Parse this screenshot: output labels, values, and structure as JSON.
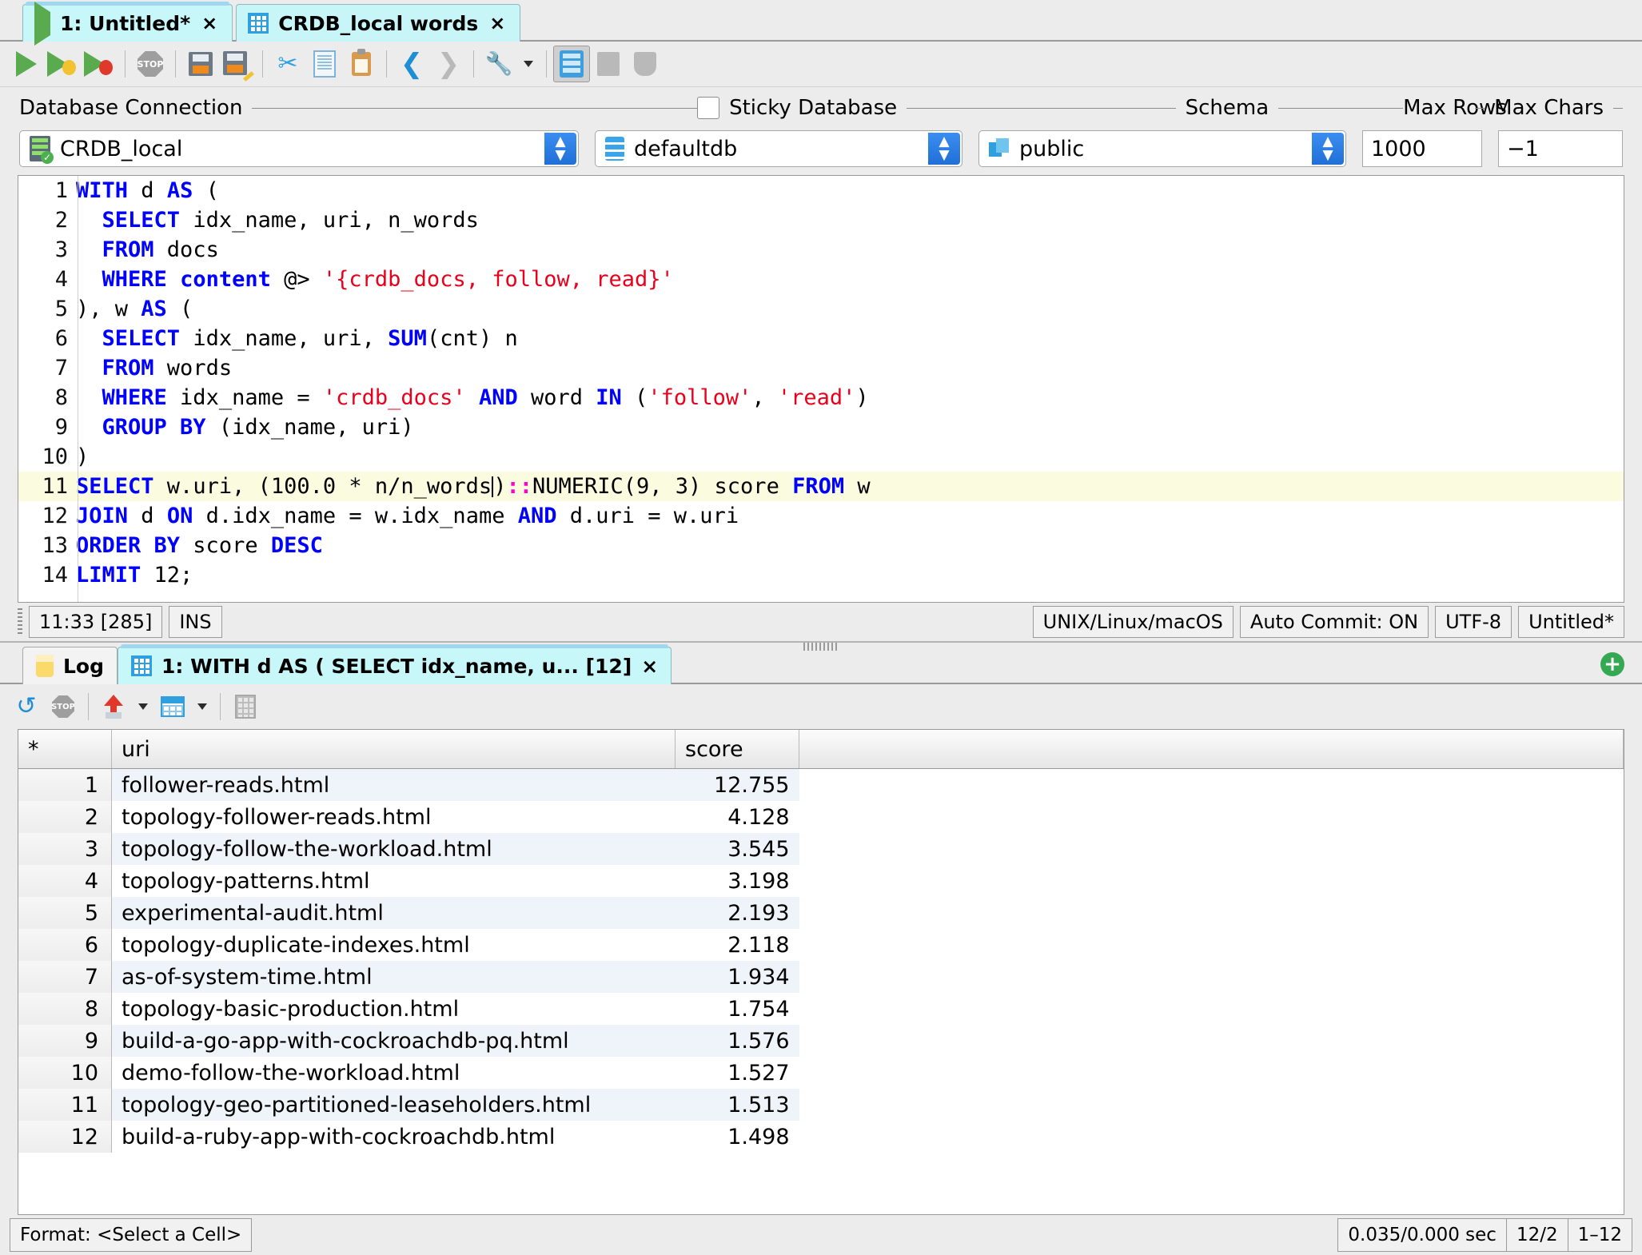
{
  "window": {
    "document_tabs": [
      {
        "label": "1: Untitled*",
        "icon": "run-script-icon",
        "close": "×",
        "active": true
      },
      {
        "label": "CRDB_local words",
        "icon": "table-grid-icon",
        "close": "×",
        "active": false
      }
    ]
  },
  "toolbar": {
    "buttons": [
      {
        "name": "execute-icon",
        "label": "Execute"
      },
      {
        "name": "execute-step-icon",
        "label": "Execute Step"
      },
      {
        "name": "execute-stop-icon",
        "label": "Execute and Stop"
      },
      {
        "name": "stop-icon",
        "label": "STOP"
      },
      {
        "name": "save-icon",
        "label": "Save"
      },
      {
        "name": "save-as-icon",
        "label": "Save As"
      },
      {
        "name": "cut-icon",
        "label": "Cut"
      },
      {
        "name": "copy-icon",
        "label": "Copy"
      },
      {
        "name": "paste-icon",
        "label": "Paste"
      },
      {
        "name": "back-icon",
        "label": "Back"
      },
      {
        "name": "forward-icon",
        "label": "Forward"
      },
      {
        "name": "tools-icon",
        "label": "Tools"
      },
      {
        "name": "database-explorer-icon",
        "label": "Database Explorer"
      },
      {
        "name": "object-view-icon",
        "label": "Object View"
      },
      {
        "name": "data-view-icon",
        "label": "Data View"
      }
    ],
    "stop_text": "STOP"
  },
  "connection": {
    "db_connection_label": "Database Connection",
    "sticky_label": "Sticky Database",
    "sticky_checked": false,
    "schema_label": "Schema",
    "max_rows_label": "Max Rows",
    "max_chars_label": "Max Chars",
    "connection_value": "CRDB_local",
    "database_value": "defaultdb",
    "schema_value": "public",
    "max_rows_value": "1000",
    "max_chars_value": "−1"
  },
  "editor": {
    "lines": [
      {
        "n": "1",
        "tokens": [
          {
            "t": "WITH",
            "c": "kw"
          },
          {
            "t": " d ",
            "c": "plain"
          },
          {
            "t": "AS",
            "c": "kw"
          },
          {
            "t": " (",
            "c": "plain"
          }
        ]
      },
      {
        "n": "2",
        "tokens": [
          {
            "t": "  ",
            "c": "plain"
          },
          {
            "t": "SELECT",
            "c": "kw"
          },
          {
            "t": " idx_name, uri, n_words",
            "c": "plain"
          }
        ]
      },
      {
        "n": "3",
        "tokens": [
          {
            "t": "  ",
            "c": "plain"
          },
          {
            "t": "FROM",
            "c": "kw"
          },
          {
            "t": " docs",
            "c": "plain"
          }
        ]
      },
      {
        "n": "4",
        "tokens": [
          {
            "t": "  ",
            "c": "plain"
          },
          {
            "t": "WHERE",
            "c": "kw"
          },
          {
            "t": " ",
            "c": "plain"
          },
          {
            "t": "content",
            "c": "kw"
          },
          {
            "t": " @> ",
            "c": "plain"
          },
          {
            "t": "'{crdb_docs, follow, read}'",
            "c": "str"
          }
        ]
      },
      {
        "n": "5",
        "tokens": [
          {
            "t": "), w ",
            "c": "plain"
          },
          {
            "t": "AS",
            "c": "kw"
          },
          {
            "t": " (",
            "c": "plain"
          }
        ]
      },
      {
        "n": "6",
        "tokens": [
          {
            "t": "  ",
            "c": "plain"
          },
          {
            "t": "SELECT",
            "c": "kw"
          },
          {
            "t": " idx_name, uri, ",
            "c": "plain"
          },
          {
            "t": "SUM",
            "c": "kw"
          },
          {
            "t": "(cnt) n",
            "c": "plain"
          }
        ]
      },
      {
        "n": "7",
        "tokens": [
          {
            "t": "  ",
            "c": "plain"
          },
          {
            "t": "FROM",
            "c": "kw"
          },
          {
            "t": " words",
            "c": "plain"
          }
        ]
      },
      {
        "n": "8",
        "tokens": [
          {
            "t": "  ",
            "c": "plain"
          },
          {
            "t": "WHERE",
            "c": "kw"
          },
          {
            "t": " idx_name = ",
            "c": "plain"
          },
          {
            "t": "'crdb_docs'",
            "c": "str"
          },
          {
            "t": " ",
            "c": "plain"
          },
          {
            "t": "AND",
            "c": "kw"
          },
          {
            "t": " word ",
            "c": "plain"
          },
          {
            "t": "IN",
            "c": "kw"
          },
          {
            "t": " (",
            "c": "plain"
          },
          {
            "t": "'follow'",
            "c": "str"
          },
          {
            "t": ", ",
            "c": "plain"
          },
          {
            "t": "'read'",
            "c": "str"
          },
          {
            "t": ")",
            "c": "plain"
          }
        ]
      },
      {
        "n": "9",
        "tokens": [
          {
            "t": "  ",
            "c": "plain"
          },
          {
            "t": "GROUP BY",
            "c": "kw"
          },
          {
            "t": " (idx_name, uri)",
            "c": "plain"
          }
        ]
      },
      {
        "n": "10",
        "tokens": [
          {
            "t": ")",
            "c": "plain"
          }
        ]
      },
      {
        "n": "11",
        "highlight": true,
        "cursor_after": 4,
        "tokens": [
          {
            "t": "SELECT",
            "c": "kw"
          },
          {
            "t": " w.uri, (100.0 * n/n_words",
            "c": "plain"
          },
          {
            "t": ")",
            "c": "plain"
          },
          {
            "t": "::",
            "c": "op"
          },
          {
            "t": "NUMERIC(9, 3) score ",
            "c": "plain"
          },
          {
            "t": "FROM",
            "c": "kw"
          },
          {
            "t": " w",
            "c": "plain"
          }
        ]
      },
      {
        "n": "12",
        "tokens": [
          {
            "t": "JOIN",
            "c": "kw"
          },
          {
            "t": " d ",
            "c": "plain"
          },
          {
            "t": "ON",
            "c": "kw"
          },
          {
            "t": " d.idx_name = w.idx_name ",
            "c": "plain"
          },
          {
            "t": "AND",
            "c": "kw"
          },
          {
            "t": " d.uri = w.uri",
            "c": "plain"
          }
        ]
      },
      {
        "n": "13",
        "tokens": [
          {
            "t": "ORDER BY",
            "c": "kw"
          },
          {
            "t": " score ",
            "c": "plain"
          },
          {
            "t": "DESC",
            "c": "kw"
          }
        ]
      },
      {
        "n": "14",
        "tokens": [
          {
            "t": "LIMIT",
            "c": "kw"
          },
          {
            "t": " 12;",
            "c": "plain"
          }
        ]
      }
    ],
    "full_text": "WITH d AS (\n  SELECT idx_name, uri, n_words\n  FROM docs\n  WHERE content @> '{crdb_docs, follow, read}'\n), w AS (\n  SELECT idx_name, uri, SUM(cnt) n\n  FROM words\n  WHERE idx_name = 'crdb_docs' AND word IN ('follow', 'read')\n  GROUP BY (idx_name, uri)\n)\nSELECT w.uri, (100.0 * n/n_words)::NUMERIC(9, 3) score FROM w\nJOIN d ON d.idx_name = w.idx_name AND d.uri = w.uri\nORDER BY score DESC\nLIMIT 12;"
  },
  "editor_status": {
    "caret": "11:33 [285]",
    "insert_mode": "INS",
    "line_ending": "UNIX/Linux/macOS",
    "auto_commit": "Auto Commit: ON",
    "encoding": "UTF-8",
    "filename": "Untitled*"
  },
  "results": {
    "tabs": [
      {
        "label": "Log",
        "icon": "log-icon",
        "active": false,
        "close": ""
      },
      {
        "label": "1: WITH d AS ( SELECT idx_name, u... [12]",
        "icon": "table-grid-icon",
        "active": true,
        "close": "×"
      }
    ],
    "add_tab": "+",
    "toolbar": [
      {
        "name": "refresh-icon",
        "label": "Refresh"
      },
      {
        "name": "stop-icon",
        "label": "STOP"
      },
      {
        "name": "export-icon",
        "label": "Export"
      },
      {
        "name": "table-view-icon",
        "label": "Table View"
      },
      {
        "name": "calc-icon",
        "label": "Calculate"
      }
    ],
    "stop_text": "STOP",
    "columns": [
      "*",
      "uri",
      "score"
    ],
    "rows": [
      {
        "n": "1",
        "uri": "follower-reads.html",
        "score": "12.755"
      },
      {
        "n": "2",
        "uri": "topology-follower-reads.html",
        "score": "4.128"
      },
      {
        "n": "3",
        "uri": "topology-follow-the-workload.html",
        "score": "3.545"
      },
      {
        "n": "4",
        "uri": "topology-patterns.html",
        "score": "3.198"
      },
      {
        "n": "5",
        "uri": "experimental-audit.html",
        "score": "2.193"
      },
      {
        "n": "6",
        "uri": "topology-duplicate-indexes.html",
        "score": "2.118"
      },
      {
        "n": "7",
        "uri": "as-of-system-time.html",
        "score": "1.934"
      },
      {
        "n": "8",
        "uri": "topology-basic-production.html",
        "score": "1.754"
      },
      {
        "n": "9",
        "uri": "build-a-go-app-with-cockroachdb-pq.html",
        "score": "1.576"
      },
      {
        "n": "10",
        "uri": "demo-follow-the-workload.html",
        "score": "1.527"
      },
      {
        "n": "11",
        "uri": "topology-geo-partitioned-leaseholders.html",
        "score": "1.513"
      },
      {
        "n": "12",
        "uri": "build-a-ruby-app-with-cockroachdb.html",
        "score": "1.498"
      }
    ]
  },
  "bottom_status": {
    "format": "Format: <Select a Cell>",
    "timing": "0.035/0.000 sec",
    "counts": "12/2",
    "range": "1–12"
  }
}
